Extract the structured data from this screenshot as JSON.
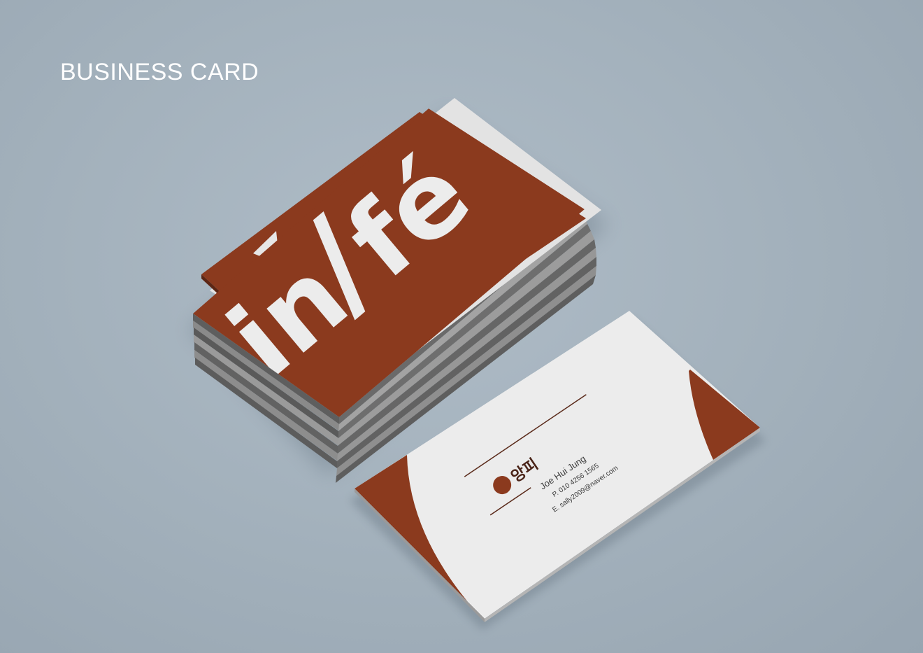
{
  "heading": "BUSINESS CARD",
  "front_card": {
    "logo_text_left": "in",
    "logo_slash": "/",
    "logo_text_right": "fé"
  },
  "back_card": {
    "brand_name": "앙피",
    "person_name": "Joe Hui Jung",
    "phone": "P. 010 4256 1565",
    "email": "E. sally2009@naver.com"
  },
  "colors": {
    "brand_brown": "#8b3a1e",
    "card_paper": "#ececec",
    "background": "#a4b2bd"
  }
}
